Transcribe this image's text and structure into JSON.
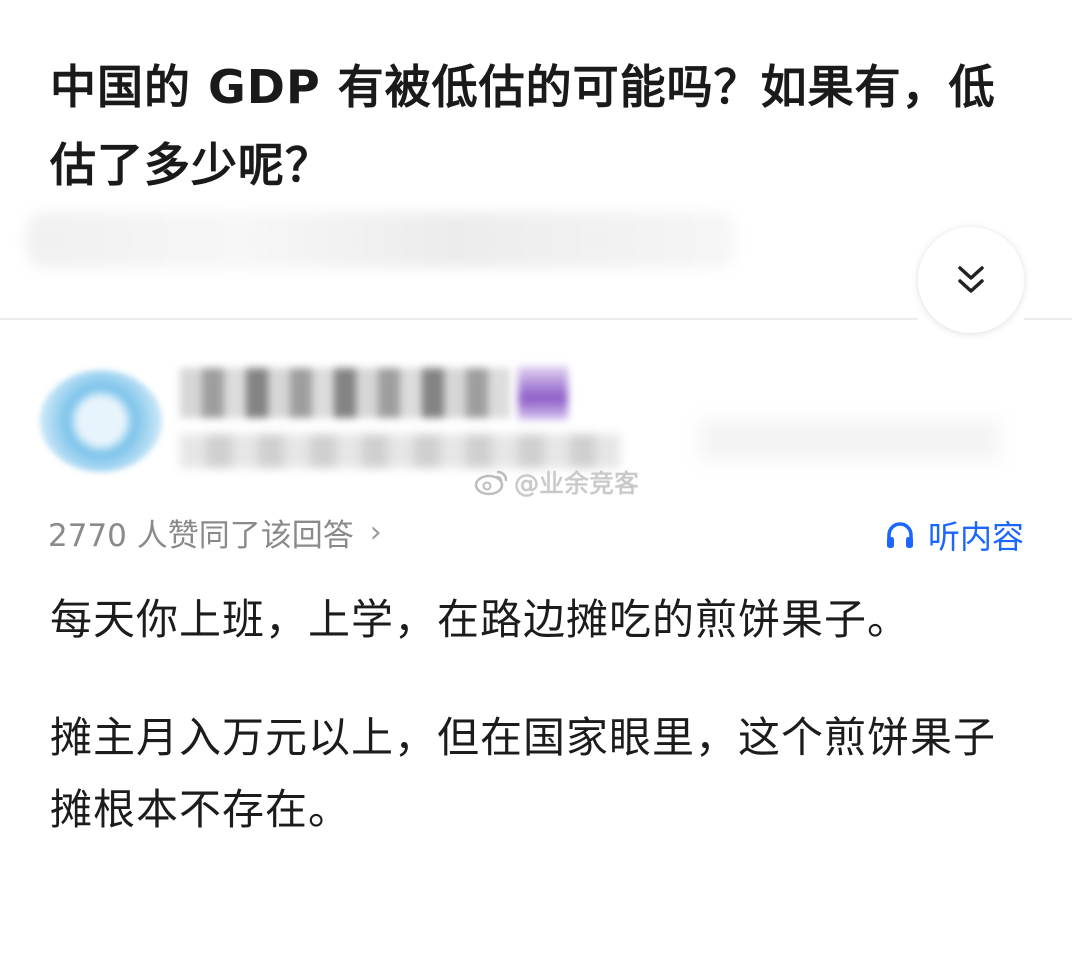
{
  "question": {
    "title": "中国的 GDP 有被低估的可能吗？如果有，低估了多少呢？"
  },
  "icons": {
    "expand": "double-chevron-down-icon",
    "listen": "headphones-icon",
    "watermark": "weibo-logo-icon"
  },
  "author": {
    "watermark_text": "@业余竞客"
  },
  "answer_meta": {
    "upvote_text": "2770 人赞同了该回答",
    "chevron": "›",
    "listen_label": "听内容"
  },
  "answer": {
    "paragraphs": [
      "每天你上班，上学，在路边摊吃的煎饼果子。",
      "摊主月入万元以上，但在国家眼里，这个煎饼果子摊根本不存在。"
    ]
  },
  "colors": {
    "accent": "#1a66ff",
    "meta_gray": "#8a8a8a"
  }
}
